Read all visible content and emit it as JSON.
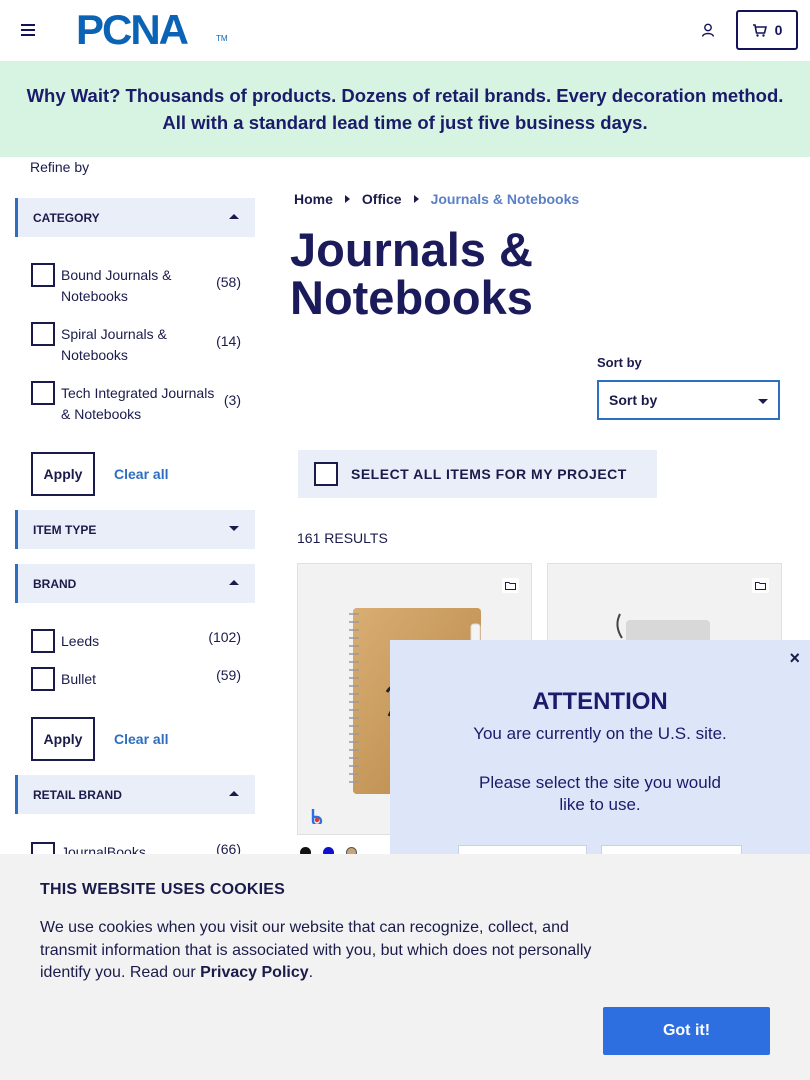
{
  "header": {
    "logo_text": "PCNA",
    "logo_tm": "TM",
    "cart_count": "0"
  },
  "banner": {
    "text": "Why Wait? Thousands of products. Dozens of retail brands. Every decoration method. All with a standard lead time of just five business days."
  },
  "sidebar": {
    "refine_label": "Refine by",
    "facets": {
      "category": {
        "title": "CATEGORY",
        "items": [
          {
            "label": "Bound Journals & Notebooks",
            "count": "(58)"
          },
          {
            "label": "Spiral Journals & Notebooks",
            "count": "(14)"
          },
          {
            "label": "Tech Integrated Journals & Notebooks",
            "count": "(3)"
          }
        ],
        "apply": "Apply",
        "clear": "Clear all"
      },
      "item_type": {
        "title": "ITEM TYPE"
      },
      "brand": {
        "title": "BRAND",
        "items": [
          {
            "label": "Leeds",
            "count": "(102)"
          },
          {
            "label": "Bullet",
            "count": "(59)"
          }
        ],
        "apply": "Apply",
        "clear": "Clear all"
      },
      "retail_brand": {
        "title": "RETAIL BRAND",
        "items": [
          {
            "label": "JournalBooks",
            "count": "(66)"
          }
        ]
      }
    }
  },
  "main": {
    "breadcrumb": [
      "Home",
      "Office",
      "Journals & Notebooks"
    ],
    "title": "Journals & Notebooks",
    "sort": {
      "label": "Sort by",
      "value": "Sort by"
    },
    "select_all": "SELECT ALL ITEMS FOR MY PROJECT",
    "results": "161 RESULTS",
    "products": [
      {
        "swatches": [
          "#111111",
          "#1010d0",
          "#c9a27a"
        ]
      },
      {
        "swatches": []
      }
    ]
  },
  "attention": {
    "close": "×",
    "title": "ATTENTION",
    "line1": "You are currently on the U.S. site.",
    "line2": "Please select the site you would like to use."
  },
  "cookies": {
    "title": "THIS WEBSITE USES COOKIES",
    "text": "We use cookies when you visit our website that can recognize, collect, and transmit information that is associated with you, but which does not personally identify you. Read our",
    "policy_link": "Privacy Policy",
    "period": ".",
    "button": "Got it!"
  },
  "colors": {
    "navy": "#1b1b4b",
    "accent_blue": "#2d6ec0",
    "banner_bg": "#d6f4e1",
    "modal_bg": "#dde6f8",
    "cookie_button": "#2d6ee0"
  }
}
